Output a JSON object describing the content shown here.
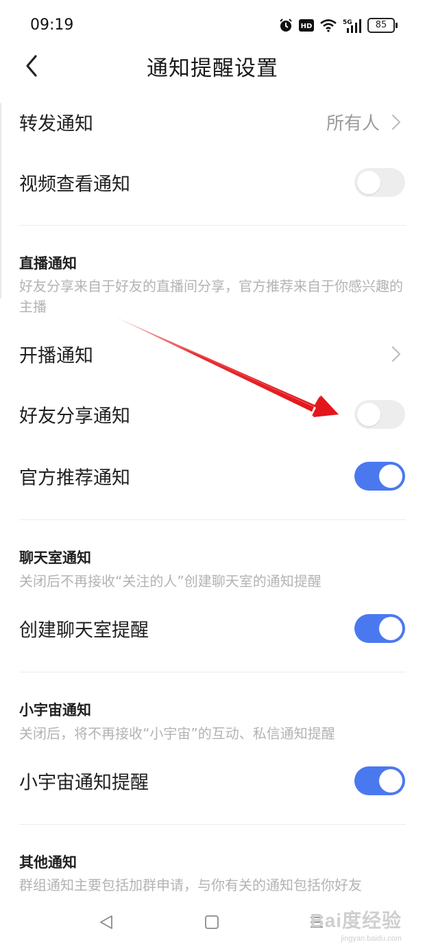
{
  "status_bar": {
    "time": "09:19",
    "battery": "85",
    "icons": [
      "alarm-icon",
      "hd-icon",
      "wifi-icon",
      "5g-signal-icon",
      "battery-icon"
    ]
  },
  "header": {
    "title": "通知提醒设置"
  },
  "rows": {
    "forward": {
      "label": "转发通知",
      "value": "所有人"
    },
    "video_view": {
      "label": "视频查看通知",
      "toggle": "off"
    }
  },
  "live": {
    "title": "直播通知",
    "desc": "好友分享来自于好友的直播间分享，官方推荐来自于你感兴趣的主播",
    "start": {
      "label": "开播通知"
    },
    "friend_share": {
      "label": "好友分享通知",
      "toggle": "off"
    },
    "official": {
      "label": "官方推荐通知",
      "toggle": "on"
    }
  },
  "chatroom": {
    "title": "聊天室通知",
    "desc": "关闭后不再接收“关注的人”创建聊天室的通知提醒",
    "create": {
      "label": "创建聊天室提醒",
      "toggle": "on"
    }
  },
  "universe": {
    "title": "小宇宙通知",
    "desc": "关闭后，将不再接收“小宇宙”的互动、私信通知提醒",
    "reminder": {
      "label": "小宇宙通知提醒",
      "toggle": "on"
    }
  },
  "other": {
    "title": "其他通知",
    "desc": "群组通知主要包括加群申请，与你有关的通知包括你好友"
  },
  "watermark": {
    "main": "Bai度经验",
    "sub": "jingyan.baidu.com"
  },
  "colors": {
    "accent": "#4a79ef",
    "toggle_off": "#ededed",
    "annotation_arrow": "#e3161b",
    "desc_text": "#b3b3b3"
  }
}
